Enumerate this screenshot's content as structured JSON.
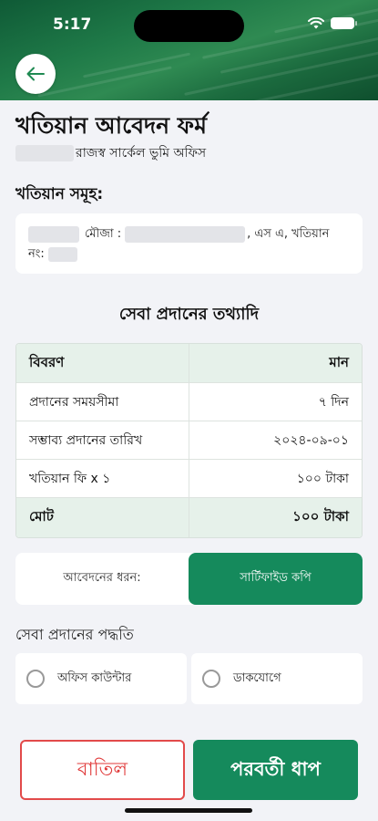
{
  "status_bar": {
    "time": "5:17"
  },
  "header": {
    "back_icon": "arrow-left-icon"
  },
  "page": {
    "title": "খতিয়ান আবেদন ফর্ম",
    "subtitle": "রাজস্ব সার্কেল ভুমি অফিস"
  },
  "khatian_section": {
    "label": "খতিয়ান সমূহ:",
    "mouza_label": "মৌজা :",
    "khatian_label": ", এস এ, খতিয়ান",
    "number_label": "নং:"
  },
  "service_info": {
    "heading": "সেবা প্রদানের তথ্যাদি",
    "columns": [
      "বিবরণ",
      "মান"
    ],
    "rows": [
      {
        "label": "প্রদানের সময়সীমা",
        "value": "৭ দিন"
      },
      {
        "label": "সম্ভাব্য প্রদানের তারিখ",
        "value": "২০২৪-০৯-০১"
      },
      {
        "label": "খতিয়ান ফি x ১",
        "value": "১০০ টাকা"
      }
    ],
    "total": {
      "label": "মোট",
      "value": "১০০ টাকা"
    }
  },
  "application_type": {
    "label": "আবেদনের ধরন:",
    "selected": "সার্টিফাইড কপি"
  },
  "delivery_method": {
    "label": "সেবা প্রদানের পদ্ধতি",
    "options": [
      "অফিস কাউন্টার",
      "ডাকযোগে"
    ]
  },
  "actions": {
    "cancel": "বাতিল",
    "next": "পরবর্তী ধাপ"
  },
  "colors": {
    "primary": "#158a5c",
    "danger": "#e03a3a",
    "table_header_bg": "#e6f1ea"
  }
}
